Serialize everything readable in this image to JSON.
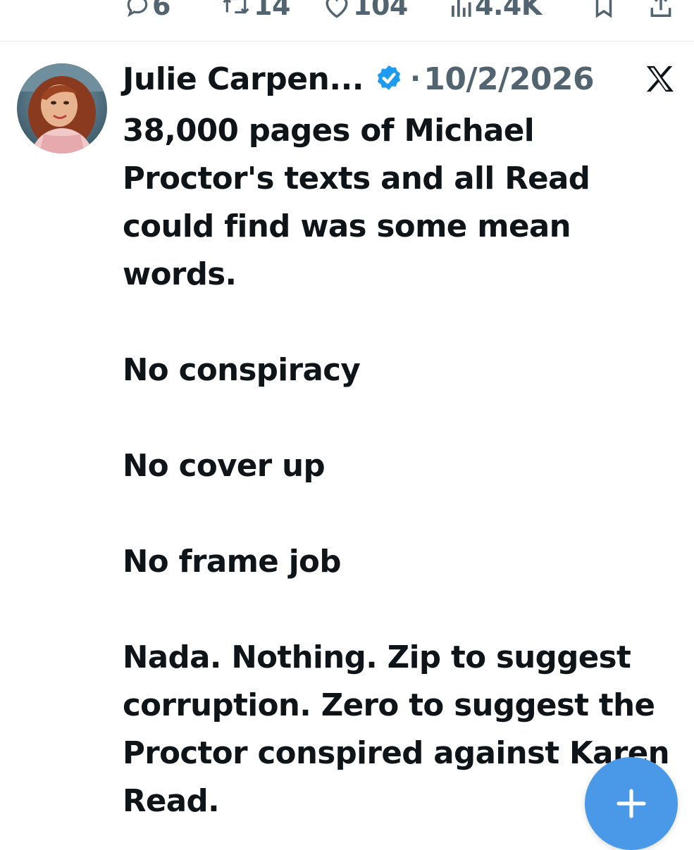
{
  "actions": {
    "replies": "6",
    "reposts": "14",
    "likes": "104",
    "views": "4.4K"
  },
  "icons": [
    "reply-icon",
    "repost-icon",
    "like-icon",
    "views-icon",
    "bookmark-icon",
    "share-icon",
    "verified-badge-icon",
    "x-logo-icon",
    "plus-icon"
  ],
  "colors": {
    "text": "#0f1419",
    "muted": "#536471",
    "verified": "#1d9bf0",
    "fab": "#4a99e9"
  },
  "tweet": {
    "author_name": "Julie Carpen...",
    "separator": "·",
    "date": "10/2/2026",
    "paragraphs": [
      "38,000 pages of Michael Proctor's texts and all Read could find was some mean words.",
      "No conspiracy",
      "No cover up",
      "No frame job",
      "Nada. Nothing. Zip to suggest corruption. Zero to suggest the Proctor conspired against Karen Read."
    ]
  }
}
